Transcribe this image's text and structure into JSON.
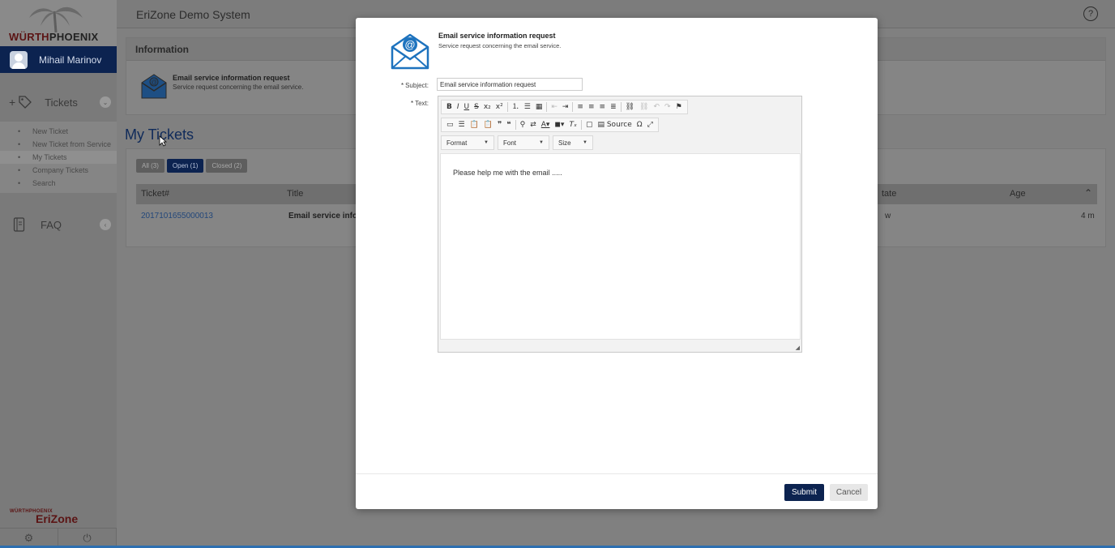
{
  "brand": {
    "logo_primary": "WÜRTH",
    "logo_secondary": "PHOENIX",
    "bottom_small": "WÜRTHPHOENIX",
    "bottom_large": "EriZone"
  },
  "user": {
    "name": "Mihail Marinov"
  },
  "nav": {
    "tickets_label": "Tickets",
    "faq_label": "FAQ",
    "sub_items": [
      "New Ticket",
      "New Ticket from Service",
      "My Tickets",
      "Company Tickets",
      "Search"
    ]
  },
  "topbar": {
    "title": "EriZone Demo System",
    "help": "?"
  },
  "info": {
    "header": "Information",
    "service_title": "Email service information request",
    "service_desc": "Service request concerning the email service."
  },
  "my_tickets": {
    "title": "My Tickets",
    "filters": {
      "all": "All (3)",
      "open": "Open (1)",
      "closed": "Closed (2)"
    },
    "columns": {
      "ticket": "Ticket#",
      "title": "Title",
      "state": "tate",
      "age": "Age"
    },
    "rows": [
      {
        "ticket": "2017101655000013",
        "title": "Email service inform",
        "state": "w",
        "age": "4 m"
      }
    ]
  },
  "modal": {
    "header_title": "Email service information request",
    "header_desc": "Service request concerning the email service.",
    "subject_label": "Subject:",
    "text_label": "Text:",
    "required_mark": "*",
    "subject_value": "Email service information request",
    "editor": {
      "format_label": "Format",
      "font_label": "Font",
      "size_label": "Size",
      "source_label": "Source",
      "body_text": "Please help me with the email ....."
    },
    "submit_label": "Submit",
    "cancel_label": "Cancel"
  },
  "colors": {
    "brand_navy": "#0c2350",
    "overlay_grey": "#808080",
    "accent_blue": "#1e73be"
  }
}
